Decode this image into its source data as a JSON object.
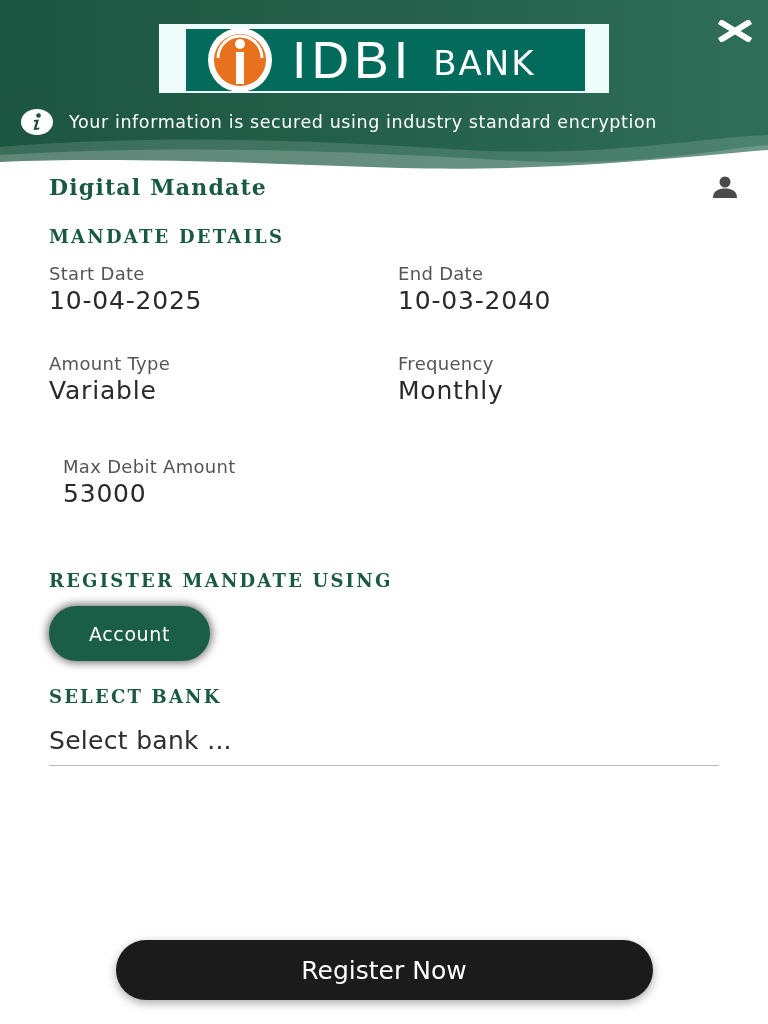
{
  "header": {
    "logo": {
      "name": "IDBI",
      "suffix": "BANK"
    },
    "notice": "Your information is secured using industry standard encryption"
  },
  "page": {
    "title": "Digital Mandate"
  },
  "mandate_details": {
    "heading": "MANDATE DETAILS",
    "fields": [
      {
        "label": "Start Date",
        "value": "10-04-2025"
      },
      {
        "label": "End Date",
        "value": "10-03-2040"
      },
      {
        "label": "Amount Type",
        "value": "Variable"
      },
      {
        "label": "Frequency",
        "value": "Monthly"
      },
      {
        "label": "Max Debit Amount",
        "value": "53000"
      }
    ]
  },
  "register_using": {
    "heading": "REGISTER MANDATE USING",
    "options": [
      {
        "label": "Account",
        "selected": true
      }
    ]
  },
  "select_bank": {
    "heading": "SELECT BANK",
    "placeholder": "Select bank ..."
  },
  "submit": {
    "label": "Register Now"
  }
}
